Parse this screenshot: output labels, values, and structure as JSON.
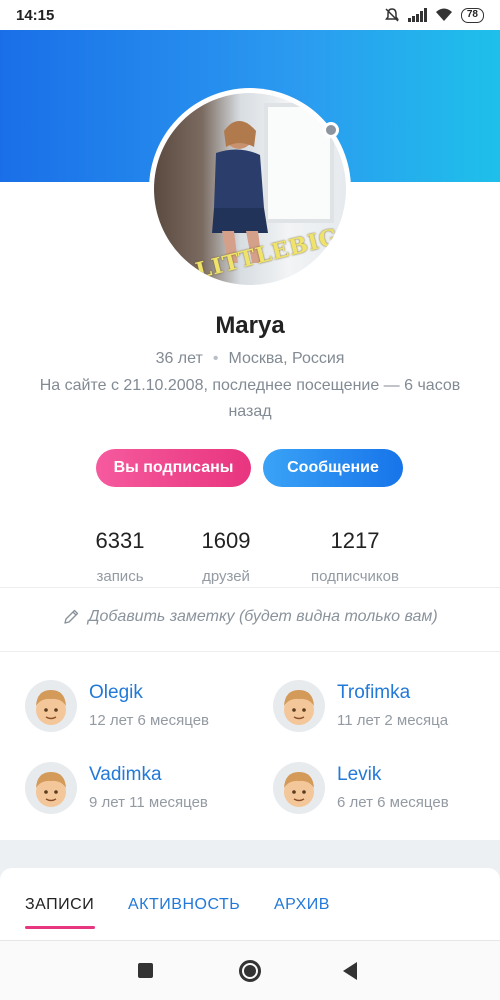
{
  "status_bar": {
    "time": "14:15",
    "battery": "78",
    "icons": [
      "mute-icon",
      "signal-icon",
      "wifi-icon",
      "battery-icon"
    ]
  },
  "profile": {
    "name": "Marya",
    "age": "36 лет",
    "city": "Москва, Россия",
    "visit": "На сайте с 21.10.2008, последнее посещение — 6 часов назад",
    "avatar_watermark": "LITTLEBIG"
  },
  "actions": {
    "subscribed_label": "Вы подписаны",
    "message_label": "Сообщение"
  },
  "counters": [
    {
      "value": "6331",
      "label": "запись"
    },
    {
      "value": "1609",
      "label": "друзей"
    },
    {
      "value": "1217",
      "label": "подписчиков"
    }
  ],
  "note": {
    "text": "Добавить заметку (будет видна только вам)"
  },
  "friends": [
    {
      "name": "Olegik",
      "time": "12 лет 6 месяцев"
    },
    {
      "name": "Trofimka",
      "time": "11 лет 2 месяца"
    },
    {
      "name": "Vadimka",
      "time": "9 лет 11 месяцев"
    },
    {
      "name": "Levik",
      "time": "6 лет 6 месяцев"
    }
  ],
  "tabs": [
    {
      "label": "ЗАПИСИ",
      "active": true
    },
    {
      "label": "АКТИВНОСТЬ",
      "active": false
    },
    {
      "label": "АРХИВ",
      "active": false
    }
  ],
  "colors": {
    "accent_blue": "#2279d8",
    "accent_pink": "#e8357f"
  }
}
